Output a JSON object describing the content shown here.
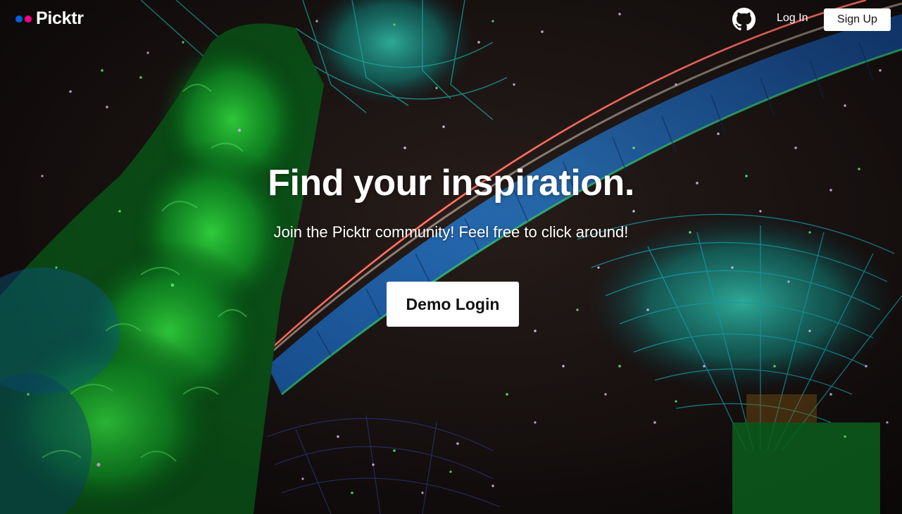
{
  "nav": {
    "brand": "Picktr",
    "github_icon": "github-icon",
    "login_label": "Log In",
    "signup_label": "Sign Up"
  },
  "hero": {
    "headline": "Find your inspiration.",
    "subhead": "Join the Picktr community! Feel free to click around!",
    "demo_button": "Demo Login",
    "background_subject": "night-garden-supertrees-photo"
  },
  "colors": {
    "brand_blue": "#0063dc",
    "brand_pink": "#ff0084",
    "text_light": "#ffffff",
    "button_bg": "#ffffff",
    "button_text": "#111111"
  }
}
